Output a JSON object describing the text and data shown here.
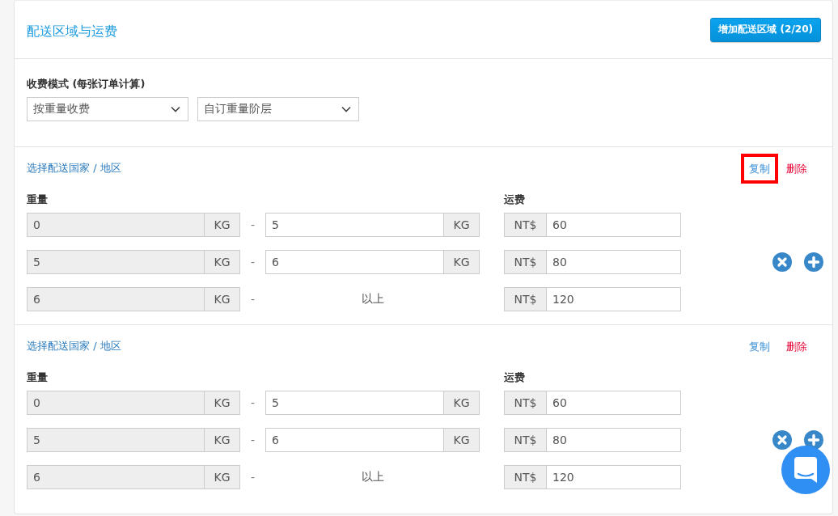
{
  "header": {
    "title": "配送区域与运费",
    "add_zone_button": "增加配送区域 (2/20)"
  },
  "charge_mode": {
    "label": "收费模式 (每张订单计算)",
    "selects": [
      {
        "value": "按重量收费"
      },
      {
        "value": "自订重量阶层"
      }
    ]
  },
  "zones": [
    {
      "region_link": "选择配送国家 / 地区",
      "actions": [
        {
          "kind": "copy",
          "label": "复制",
          "highlighted": true
        },
        {
          "kind": "delete",
          "label": "删除",
          "highlighted": false
        }
      ],
      "weight_label": "重量",
      "fee_label": "运费",
      "tiers": [
        {
          "kind": "range",
          "from": {
            "value": "0",
            "unit": "KG",
            "disabled": true
          },
          "separator": "-",
          "to": {
            "value": "5",
            "unit": "KG",
            "disabled": false
          },
          "fee": {
            "currency": "NT$",
            "value": "60"
          },
          "removable": false,
          "addable": false
        },
        {
          "kind": "range",
          "from": {
            "value": "5",
            "unit": "KG",
            "disabled": true
          },
          "separator": "-",
          "to": {
            "value": "6",
            "unit": "KG",
            "disabled": false
          },
          "fee": {
            "currency": "NT$",
            "value": "80"
          },
          "removable": true,
          "addable": true
        },
        {
          "kind": "open",
          "from": {
            "value": "6",
            "unit": "KG",
            "disabled": true
          },
          "separator": "-",
          "above": "以上",
          "fee": {
            "currency": "NT$",
            "value": "120"
          },
          "removable": false,
          "addable": false
        }
      ]
    },
    {
      "region_link": "选择配送国家 / 地区",
      "actions": [
        {
          "kind": "copy",
          "label": "复制",
          "highlighted": false
        },
        {
          "kind": "delete",
          "label": "删除",
          "highlighted": false
        }
      ],
      "weight_label": "重量",
      "fee_label": "运费",
      "tiers": [
        {
          "kind": "range",
          "from": {
            "value": "0",
            "unit": "KG",
            "disabled": true
          },
          "separator": "-",
          "to": {
            "value": "5",
            "unit": "KG",
            "disabled": false
          },
          "fee": {
            "currency": "NT$",
            "value": "60"
          },
          "removable": false,
          "addable": false
        },
        {
          "kind": "range",
          "from": {
            "value": "5",
            "unit": "KG",
            "disabled": true
          },
          "separator": "-",
          "to": {
            "value": "6",
            "unit": "KG",
            "disabled": false
          },
          "fee": {
            "currency": "NT$",
            "value": "80"
          },
          "removable": true,
          "addable": true
        },
        {
          "kind": "open",
          "from": {
            "value": "6",
            "unit": "KG",
            "disabled": true
          },
          "separator": "-",
          "above": "以上",
          "fee": {
            "currency": "NT$",
            "value": "120"
          },
          "removable": false,
          "addable": false
        }
      ]
    }
  ]
}
